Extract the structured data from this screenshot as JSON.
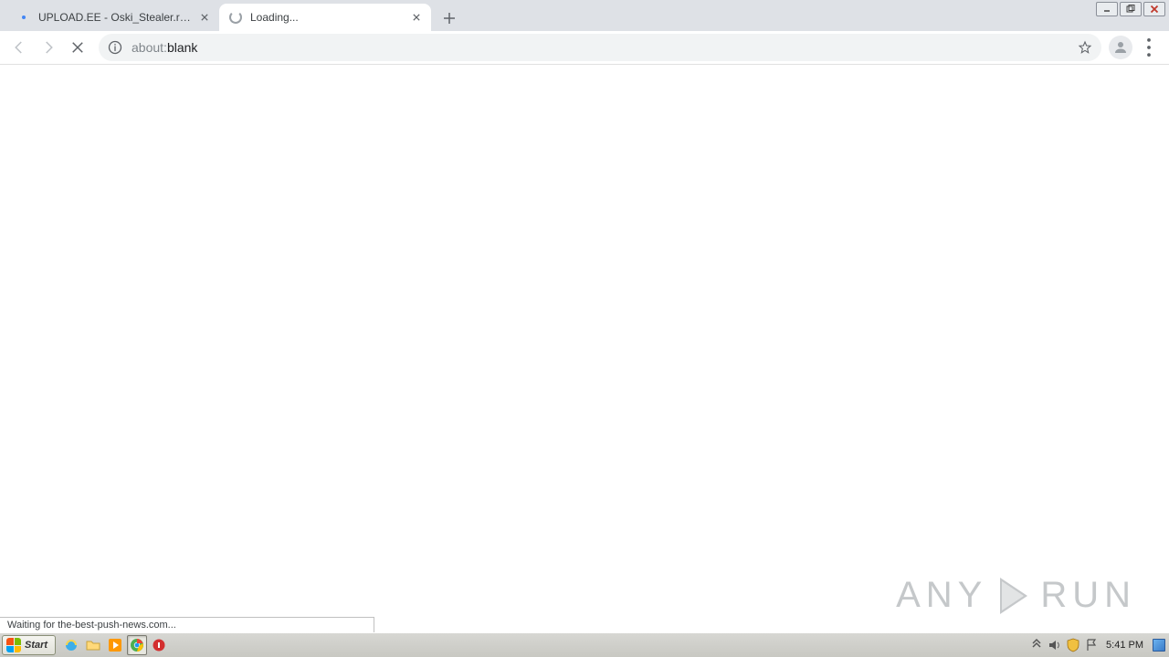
{
  "tabs": [
    {
      "title": "UPLOAD.EE - Oski_Stealer.rar - Dow",
      "loading": false
    },
    {
      "title": "Loading...",
      "loading": true
    }
  ],
  "omnibox": {
    "url_prefix": "about:",
    "url_main": "blank"
  },
  "status_text": "Waiting for the-best-push-news.com...",
  "watermark": {
    "left": "ANY",
    "right": "RUN"
  },
  "taskbar": {
    "start_label": "Start",
    "clock": "5:41 PM"
  }
}
